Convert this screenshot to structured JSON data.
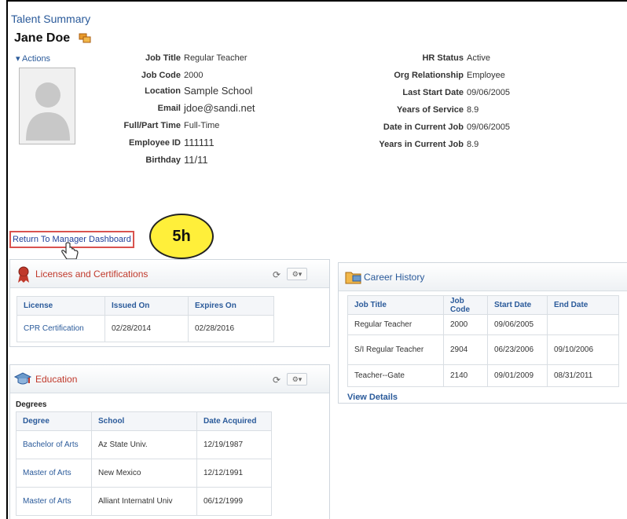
{
  "page_title": "Talent Summary",
  "employee": {
    "name": "Jane Doe"
  },
  "actions_label": "Actions",
  "fields_left": [
    {
      "label": "Job Title",
      "value": "Regular Teacher"
    },
    {
      "label": "Job Code",
      "value": "2000"
    },
    {
      "label": "Location",
      "value": "Sample School"
    },
    {
      "label": "Email",
      "value": "jdoe@sandi.net"
    },
    {
      "label": "Full/Part Time",
      "value": "Full-Time"
    },
    {
      "label": "Employee ID",
      "value": "111111"
    },
    {
      "label": "Birthday",
      "value": "11/11"
    }
  ],
  "fields_right": [
    {
      "label": "HR Status",
      "value": "Active"
    },
    {
      "label": "Org Relationship",
      "value": "Employee"
    },
    {
      "label": "Last Start Date",
      "value": "09/06/2005"
    },
    {
      "label": "Years of Service",
      "value": "8.9"
    },
    {
      "label": "Date in Current Job",
      "value": "09/06/2005"
    },
    {
      "label": "Years in Current Job",
      "value": "8.9"
    }
  ],
  "return_link": "Return To Manager Dashboard",
  "callout": "5h",
  "licenses": {
    "title": "Licenses and Certifications",
    "columns": [
      "License",
      "Issued On",
      "Expires On"
    ],
    "rows": [
      [
        "CPR Certification",
        "02/28/2014",
        "02/28/2016"
      ]
    ]
  },
  "career": {
    "title": "Career History",
    "columns": [
      "Job Title",
      "Job Code",
      "Start Date",
      "End Date"
    ],
    "rows": [
      [
        "Regular Teacher",
        "2000",
        "09/06/2005",
        ""
      ],
      [
        "S/I Regular Teacher",
        "2904",
        "06/23/2006",
        "09/10/2006"
      ],
      [
        "Teacher--Gate",
        "2140",
        "09/01/2009",
        "08/31/2011"
      ]
    ],
    "view_details": "View Details"
  },
  "education": {
    "title": "Education",
    "degrees_label": "Degrees",
    "columns": [
      "Degree",
      "School",
      "Date Acquired"
    ],
    "rows": [
      [
        "Bachelor of Arts",
        "Az State Univ.",
        "12/19/1987"
      ],
      [
        "Master of Arts",
        "New Mexico",
        "12/12/1991"
      ],
      [
        "Master of Arts",
        "Alliant Internatnl Univ",
        "06/12/1999"
      ]
    ]
  }
}
